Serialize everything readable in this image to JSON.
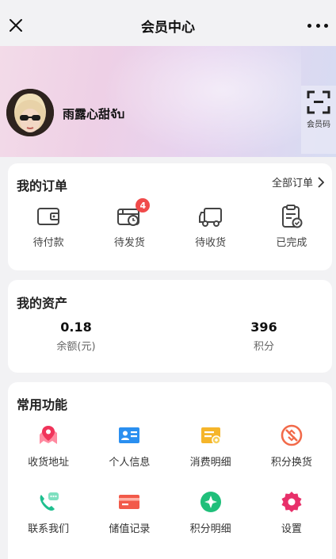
{
  "header": {
    "title": "会员中心"
  },
  "profile": {
    "username": "雨露心甜จับ",
    "qr_label": "会员码"
  },
  "orders": {
    "title": "我的订单",
    "all_label": "全部订单",
    "items": [
      {
        "label": "待付款",
        "icon": "wallet-icon"
      },
      {
        "label": "待发货",
        "icon": "box-clock-icon",
        "badge": "4"
      },
      {
        "label": "待收货",
        "icon": "truck-icon"
      },
      {
        "label": "已完成",
        "icon": "clipboard-check-icon"
      }
    ]
  },
  "assets": {
    "title": "我的资产",
    "balance": {
      "value": "0.18",
      "label": "余额(元)"
    },
    "points": {
      "value": "396",
      "label": "积分"
    }
  },
  "functions": {
    "title": "常用功能",
    "items": [
      {
        "label": "收货地址",
        "icon": "map-pin-icon",
        "color": "#f0345a"
      },
      {
        "label": "个人信息",
        "icon": "id-card-icon",
        "color": "#2a8ff0"
      },
      {
        "label": "消费明细",
        "icon": "receipt-icon",
        "color": "#f5b52a"
      },
      {
        "label": "积分换货",
        "icon": "exchange-icon",
        "color": "#f26a4a"
      },
      {
        "label": "联系我们",
        "icon": "phone-chat-icon",
        "color": "#1fbf8f"
      },
      {
        "label": "储值记录",
        "icon": "card-icon",
        "color": "#f25a4a"
      },
      {
        "label": "积分明细",
        "icon": "points-icon",
        "color": "#1fbf7a"
      },
      {
        "label": "设置",
        "icon": "settings-icon",
        "color": "#e8306a"
      }
    ]
  }
}
